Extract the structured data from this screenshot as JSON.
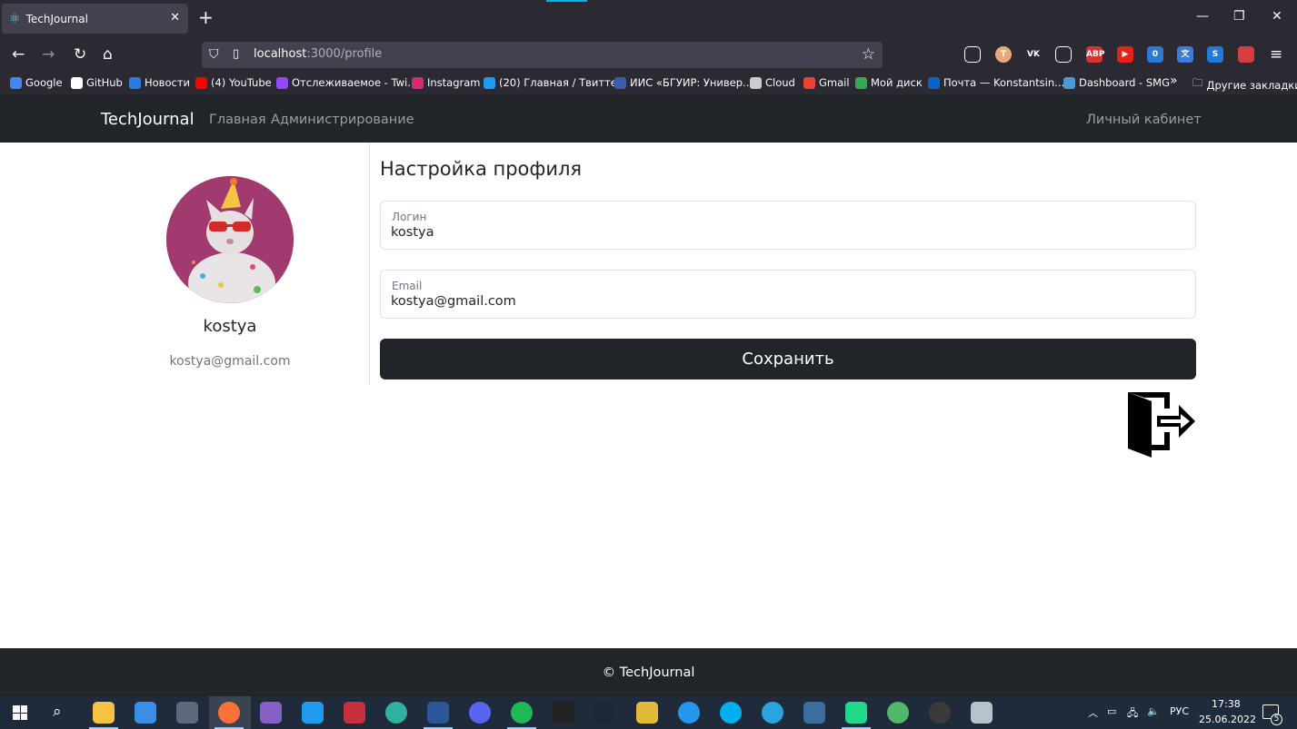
{
  "browser": {
    "tab_title": "TechJournal",
    "tab_close": "✕",
    "new_tab": "+",
    "url_host": "localhost",
    "url_path": ":3000/profile",
    "extensions": [
      {
        "name": "pocket-icon",
        "label": "",
        "color": "#2b2a33"
      },
      {
        "name": "translate-t-icon",
        "label": "T",
        "color": "#e8a87c"
      },
      {
        "name": "vk-icon",
        "label": "VK",
        "color": "#2b2a33"
      },
      {
        "name": "reader-icon",
        "label": "",
        "color": "#2b2a33"
      },
      {
        "name": "adblock-icon",
        "label": "ABP",
        "color": "#d6322f"
      },
      {
        "name": "youtube-ext-icon",
        "label": "▶",
        "color": "#e62117"
      },
      {
        "name": "counter-ext-icon",
        "label": "0",
        "color": "#2b7bd6"
      },
      {
        "name": "translator-icon",
        "label": "文",
        "color": "#3d7bd9"
      },
      {
        "name": "skype-ext-icon",
        "label": "S",
        "color": "#1f7ad9"
      },
      {
        "name": "toolbox-icon",
        "label": "",
        "color": "#d33f3f"
      }
    ],
    "bookmarks": [
      {
        "label": "Google",
        "color": "#4285f4"
      },
      {
        "label": "GitHub",
        "color": "#ffffff"
      },
      {
        "label": "Новости",
        "color": "#2d7be0"
      },
      {
        "label": "(4) YouTube",
        "color": "#ff0000"
      },
      {
        "label": "Отслеживаемое - Twi...",
        "color": "#9146ff"
      },
      {
        "label": "Instagram",
        "color": "#d62976"
      },
      {
        "label": "(20) Главная / Твиттер",
        "color": "#1d9bf0"
      },
      {
        "label": "ИИС «БГУИР: Универ...",
        "color": "#3a5ea8"
      },
      {
        "label": "Cloud",
        "color": "#cccccc"
      },
      {
        "label": "Gmail",
        "color": "#ea4335"
      },
      {
        "label": "Мой диск",
        "color": "#34a853"
      },
      {
        "label": "Почта — Konstantsin....",
        "color": "#0a64c8"
      },
      {
        "label": "Dashboard - SMG",
        "color": "#4a9bd1"
      }
    ],
    "more_bookmarks": "»",
    "other_bookmarks": "Другие закладки"
  },
  "app": {
    "brand": "TechJournal",
    "nav": [
      "Главная",
      "Администрирование"
    ],
    "account": "Личный кабинет"
  },
  "profile": {
    "username": "kostya",
    "email": "kostya@gmail.com"
  },
  "form": {
    "title": "Настройка профиля",
    "login_label": "Логин",
    "login_value": "kostya",
    "email_label": "Email",
    "email_value": "kostya@gmail.com",
    "save": "Сохранить"
  },
  "footer": {
    "text": "© TechJournal"
  },
  "taskbar": {
    "apps": [
      {
        "name": "explorer-icon",
        "color": "#f5c242"
      },
      {
        "name": "mail-icon",
        "color": "#3a8ee6"
      },
      {
        "name": "calculator-icon",
        "color": "#5b6b7c"
      },
      {
        "name": "firefox-icon",
        "color": "#ff7139"
      },
      {
        "name": "visual-studio-icon",
        "color": "#8661c5"
      },
      {
        "name": "vscode-icon",
        "color": "#1f9cf0"
      },
      {
        "name": "rider-icon",
        "color": "#c9303d"
      },
      {
        "name": "edge-icon",
        "color": "#2fb1a0"
      },
      {
        "name": "word-icon",
        "color": "#2b5797"
      },
      {
        "name": "discord-icon",
        "color": "#5865f2"
      },
      {
        "name": "spotify-icon",
        "color": "#1db954"
      },
      {
        "name": "epic-games-icon",
        "color": "#222222"
      },
      {
        "name": "steam-icon",
        "color": "#1b2838"
      },
      {
        "name": "tool-icon",
        "color": "#e2b93b"
      },
      {
        "name": "docker-icon",
        "color": "#2496ed"
      },
      {
        "name": "skype-icon",
        "color": "#00aff0"
      },
      {
        "name": "telegram-icon",
        "color": "#2aa3df"
      },
      {
        "name": "sql-icon",
        "color": "#3b6e9e"
      },
      {
        "name": "pycharm-icon",
        "color": "#21d789"
      },
      {
        "name": "vpn-icon",
        "color": "#4fb86a"
      },
      {
        "name": "wot-icon",
        "color": "#3a3a3a"
      },
      {
        "name": "db-icon",
        "color": "#b8c2cc"
      }
    ],
    "lang": "РУС",
    "time": "17:38",
    "date": "25.06.2022",
    "notifications": "5"
  }
}
